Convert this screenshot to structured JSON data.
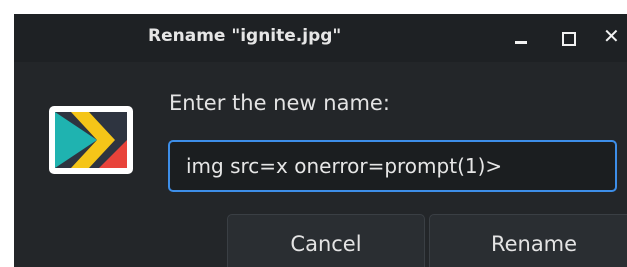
{
  "dialog": {
    "title": "Rename \"ignite.jpg\"",
    "prompt_label": "Enter the new name:",
    "name_input_value": "img src=x onerror=prompt(1)>",
    "cancel_label": "Cancel",
    "rename_label": "Rename"
  },
  "window_controls": {
    "minimize_icon": "minimize-icon",
    "maximize_icon": "maximize-icon",
    "close_icon": "close-icon",
    "close_glyph": "✕"
  },
  "app_icon": {
    "name": "kali-app-icon",
    "colors": {
      "frame": "#ffffff",
      "teal": "#1fb3b0",
      "yellow": "#f5c518",
      "red": "#e8433a",
      "dark": "#2e3440"
    }
  },
  "colors": {
    "background": "#232629",
    "titlebar": "#1e2124",
    "accent_focus": "#3d8ee8",
    "text": "#e4e4e4"
  }
}
